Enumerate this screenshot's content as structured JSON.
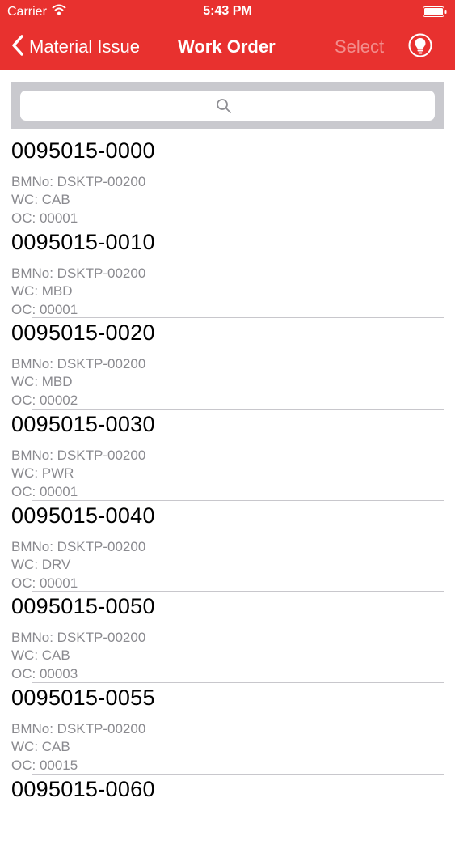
{
  "status_bar": {
    "carrier": "Carrier",
    "time": "5:43 PM"
  },
  "nav": {
    "back_label": "Material Issue",
    "title": "Work Order",
    "select_label": "Select"
  },
  "search": {
    "placeholder": ""
  },
  "colors": {
    "header": "#e8312f",
    "search_bar": "#c9c9ce",
    "secondary_text": "#8a8a8f"
  },
  "work_orders": [
    {
      "number": "0095015-0000",
      "bmno": "BMNo: DSKTP-00200",
      "wc": "WC: CAB",
      "oc": "OC: 00001"
    },
    {
      "number": "0095015-0010",
      "bmno": "BMNo: DSKTP-00200",
      "wc": "WC: MBD",
      "oc": "OC: 00001"
    },
    {
      "number": "0095015-0020",
      "bmno": "BMNo: DSKTP-00200",
      "wc": "WC: MBD",
      "oc": "OC: 00002"
    },
    {
      "number": "0095015-0030",
      "bmno": "BMNo: DSKTP-00200",
      "wc": "WC: PWR",
      "oc": "OC: 00001"
    },
    {
      "number": "0095015-0040",
      "bmno": "BMNo: DSKTP-00200",
      "wc": "WC: DRV",
      "oc": "OC: 00001"
    },
    {
      "number": "0095015-0050",
      "bmno": "BMNo: DSKTP-00200",
      "wc": "WC: CAB",
      "oc": "OC: 00003"
    },
    {
      "number": "0095015-0055",
      "bmno": "BMNo: DSKTP-00200",
      "wc": "WC: CAB",
      "oc": "OC: 00015"
    },
    {
      "number": "0095015-0060"
    }
  ]
}
